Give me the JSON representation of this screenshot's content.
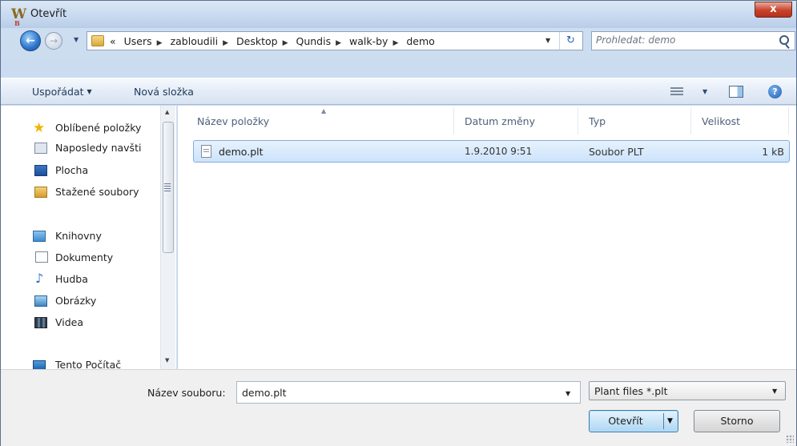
{
  "window": {
    "title": "Otevřít",
    "app_icon_letter": "W",
    "close_label": "x"
  },
  "navbar": {
    "breadcrumb": [
      "«",
      "Users",
      "zabloudili",
      "Desktop",
      "Qundis",
      "walk-by",
      "demo"
    ],
    "search_placeholder": "Prohledat: demo"
  },
  "toolbar": {
    "organize_label": "Uspořádat",
    "new_folder_label": "Nová složka"
  },
  "navpane": {
    "favorites_header": "Oblíbené položky",
    "favorites": [
      "Naposledy navšti",
      "Plocha",
      "Stažené soubory"
    ],
    "libraries_header": "Knihovny",
    "libraries": [
      "Dokumenty",
      "Hudba",
      "Obrázky",
      "Videa"
    ],
    "computer_header": "Tento Počítač"
  },
  "filelist": {
    "columns": [
      "Název položky",
      "Datum změny",
      "Typ",
      "Velikost"
    ],
    "rows": [
      {
        "name": "demo.plt",
        "date": "1.9.2010 9:51",
        "type": "Soubor PLT",
        "size": "1 kB"
      }
    ]
  },
  "bottom": {
    "filename_label": "Název souboru:",
    "filename_value": "demo.plt",
    "filter_value": "Plant files *.plt",
    "open_label": "Otevřít",
    "cancel_label": "Storno"
  }
}
